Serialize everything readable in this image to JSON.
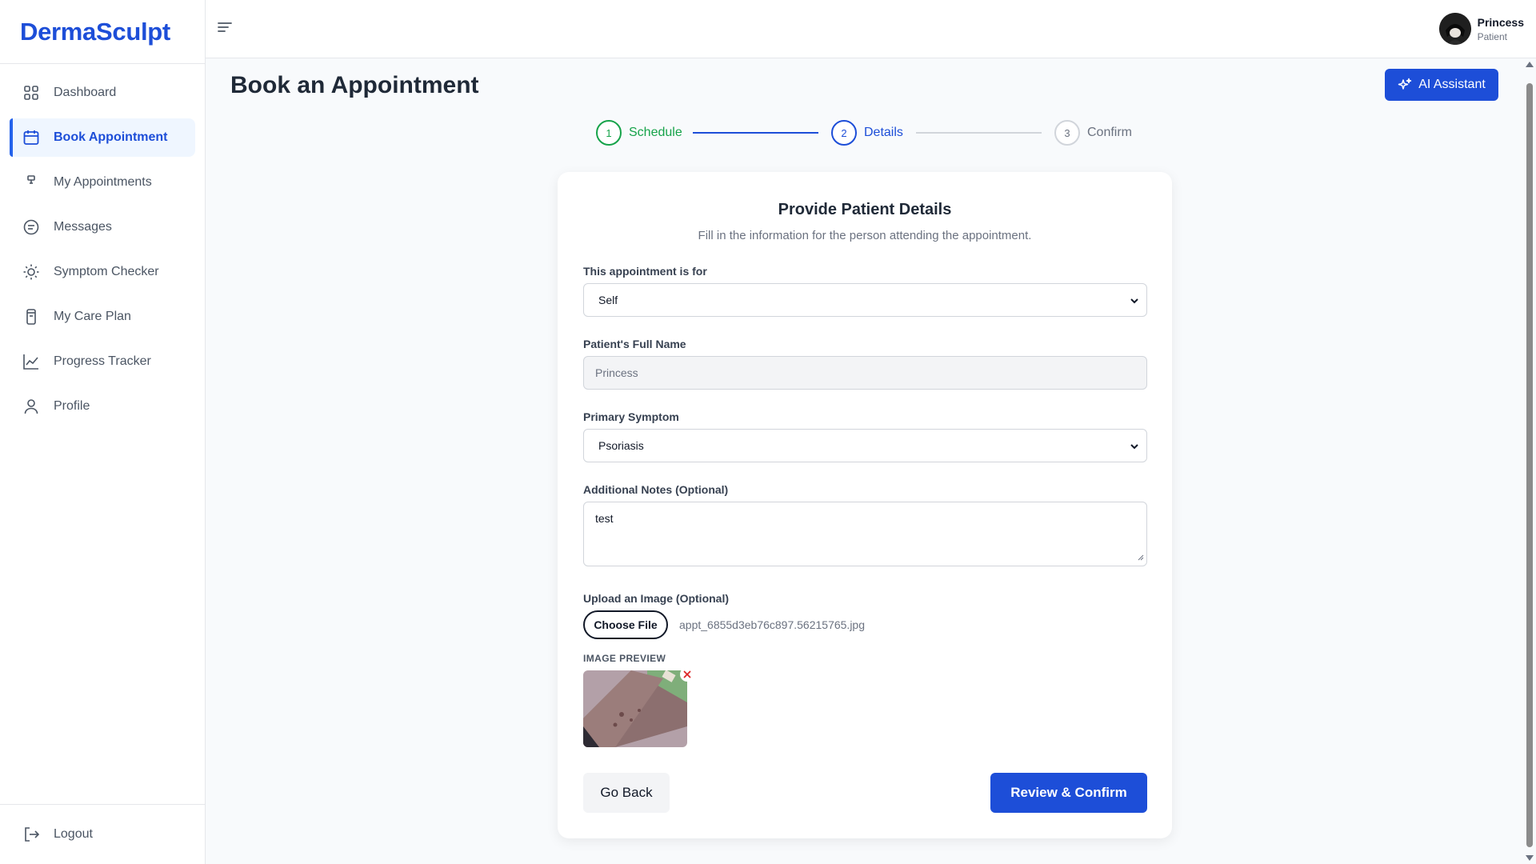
{
  "app": {
    "brand": "DermaSculpt"
  },
  "sidebar": {
    "items": [
      {
        "label": "Dashboard",
        "icon": "grid-icon",
        "active": false
      },
      {
        "label": "Book Appointment",
        "icon": "calendar-icon",
        "active": true
      },
      {
        "label": "My Appointments",
        "icon": "appointments-icon",
        "active": false
      },
      {
        "label": "Messages",
        "icon": "message-icon",
        "active": false
      },
      {
        "label": "Symptom Checker",
        "icon": "sun-icon",
        "active": false
      },
      {
        "label": "My Care Plan",
        "icon": "clipboard-icon",
        "active": false
      },
      {
        "label": "Progress Tracker",
        "icon": "chart-line-icon",
        "active": false
      },
      {
        "label": "Profile",
        "icon": "user-icon",
        "active": false
      }
    ],
    "logout": "Logout"
  },
  "topbar": {
    "user_name": "Princess",
    "user_role": "Patient"
  },
  "page": {
    "title": "Book an Appointment",
    "ai_button": "AI Assistant"
  },
  "stepper": {
    "steps": [
      {
        "number": "1",
        "label": "Schedule",
        "state": "done"
      },
      {
        "number": "2",
        "label": "Details",
        "state": "current"
      },
      {
        "number": "3",
        "label": "Confirm",
        "state": "pending"
      }
    ]
  },
  "form": {
    "title": "Provide Patient Details",
    "subtitle": "Fill in the information for the person attending the appointment.",
    "appointment_for_label": "This appointment is for",
    "appointment_for_value": "Self",
    "full_name_label": "Patient's Full Name",
    "full_name_value": "Princess",
    "symptom_label": "Primary Symptom",
    "symptom_value": "Psoriasis",
    "notes_label": "Additional Notes (Optional)",
    "notes_value": "test",
    "upload_label": "Upload an Image (Optional)",
    "choose_file": "Choose File",
    "file_name": "appt_6855d3eb76c897.56215765.jpg",
    "preview_label": "IMAGE PREVIEW",
    "back_button": "Go Back",
    "confirm_button": "Review & Confirm"
  },
  "colors": {
    "primary": "#1d4ed8",
    "success": "#16a34a",
    "danger": "#dc2626",
    "active_bg": "#eff6ff"
  }
}
